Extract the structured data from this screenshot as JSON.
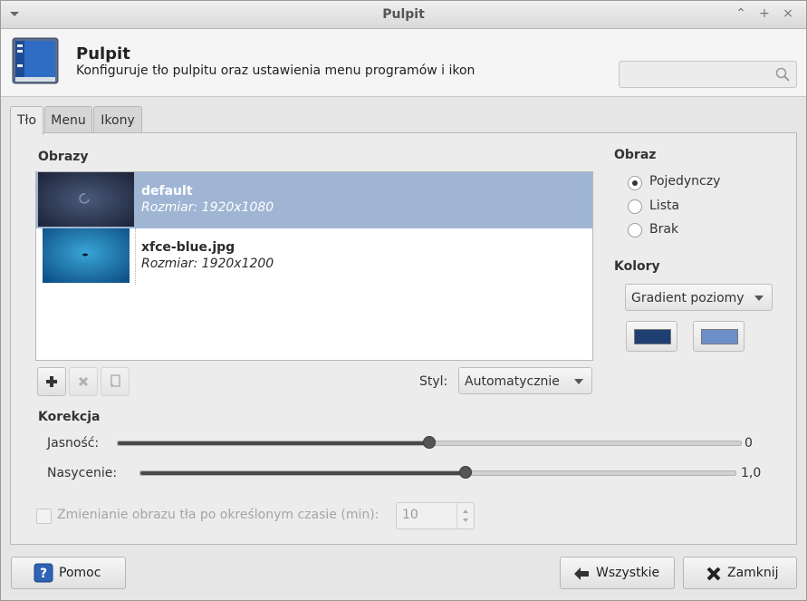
{
  "window": {
    "title": "Pulpit"
  },
  "header": {
    "title": "Pulpit",
    "subtitle": "Konfiguruje tło pulpitu oraz ustawienia menu programów i ikon",
    "search_placeholder": ""
  },
  "tabs": [
    {
      "label": "Tło",
      "active": true
    },
    {
      "label": "Menu",
      "active": false
    },
    {
      "label": "Ikony",
      "active": false
    }
  ],
  "images": {
    "section_label": "Obrazy",
    "items": [
      {
        "name": "default",
        "size": "Rozmiar: 1920x1080",
        "selected": true
      },
      {
        "name": "xfce-blue.jpg",
        "size": "Rozmiar: 1920x1200",
        "selected": false
      }
    ]
  },
  "style": {
    "label": "Styl:",
    "value": "Automatycznie"
  },
  "image_mode": {
    "section_label": "Obraz",
    "options": [
      {
        "label": "Pojedynczy",
        "checked": true
      },
      {
        "label": "Lista",
        "checked": false
      },
      {
        "label": "Brak",
        "checked": false
      }
    ]
  },
  "colors": {
    "section_label": "Kolory",
    "mode": "Gradient poziomy",
    "color1": "#1f3f73",
    "color2": "#6d8fc9"
  },
  "correction": {
    "section_label": "Korekcja",
    "brightness": {
      "label": "Jasność:",
      "value": "0",
      "fraction": 0.5
    },
    "saturation": {
      "label": "Nasycenie:",
      "value": "1,0",
      "fraction": 0.546
    }
  },
  "timer": {
    "label": "Zmienianie obrazu tła po określonym czasie (min):",
    "value": "10",
    "enabled": false
  },
  "buttons": {
    "help": "Pomoc",
    "all": "Wszystkie",
    "close": "Zamknij"
  }
}
